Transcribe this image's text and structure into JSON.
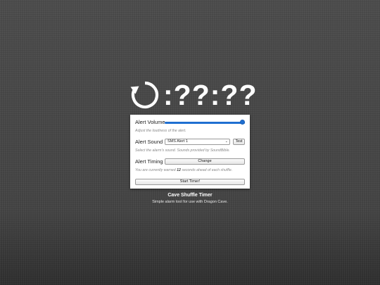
{
  "timer": {
    "icon": "refresh-icon",
    "display": ":??:??"
  },
  "settings": {
    "volume": {
      "label": "Alert Volume",
      "level_fraction": 1.0,
      "hint": "Adjust the loudness of the alert."
    },
    "sound": {
      "label": "Alert Sound",
      "selected": "SMS Alert 1",
      "test_label": "Test",
      "hint": "Select the alarm's sound. Sounds provided by SoundBible."
    },
    "timing": {
      "label": "Alert Timing",
      "change_label": "Change",
      "hint_prefix": "You are currently warned ",
      "seconds": "12",
      "hint_suffix": " seconds ahead of each shuffle."
    },
    "start_label": "Start Timer!"
  },
  "footer": {
    "title": "Cave Shuffle Timer",
    "subtitle": "Simple alarm tool for use with Dragon Cave."
  },
  "colors": {
    "accent": "#1f6fd1",
    "background": "#474747",
    "panel": "#ffffff"
  }
}
